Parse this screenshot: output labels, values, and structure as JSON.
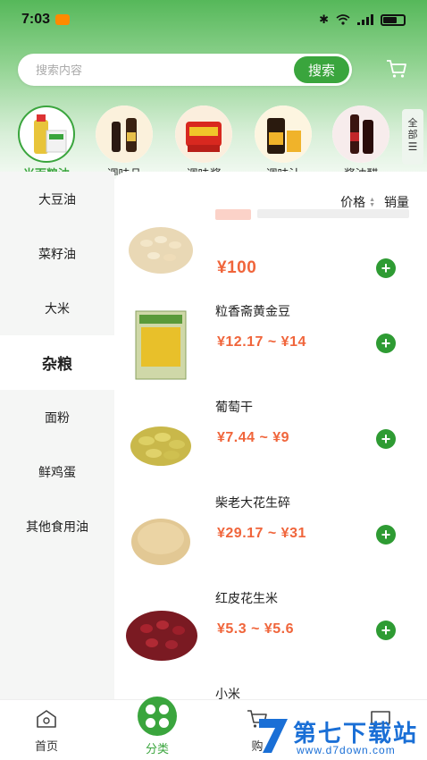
{
  "status_bar": {
    "time": "7:03"
  },
  "search": {
    "placeholder": "搜索内容",
    "button_label": "搜索"
  },
  "categories": [
    {
      "label": "米面粮油",
      "active": true
    },
    {
      "label": "调味品",
      "active": false
    },
    {
      "label": "调味酱",
      "active": false
    },
    {
      "label": "调味汁",
      "active": false
    },
    {
      "label": "酱油醋",
      "active": false
    }
  ],
  "all_button": {
    "label_line1": "全",
    "label_line2": "部"
  },
  "sidebar": {
    "items": [
      {
        "label": "大豆油"
      },
      {
        "label": "菜籽油"
      },
      {
        "label": "大米"
      },
      {
        "label": "杂粮",
        "active": true
      },
      {
        "label": "面粉"
      },
      {
        "label": "鲜鸡蛋"
      },
      {
        "label": "其他食用油"
      }
    ]
  },
  "sort": {
    "price_label": "价格",
    "sales_label": "销量"
  },
  "products": [
    {
      "name": "",
      "price": "¥100"
    },
    {
      "name": "粒香斋黄金豆",
      "price": "¥12.17 ~ ¥14"
    },
    {
      "name": "葡萄干",
      "price": "¥7.44 ~ ¥9"
    },
    {
      "name": "柴老大花生碎",
      "price": "¥29.17 ~ ¥31"
    },
    {
      "name": "红皮花生米",
      "price": "¥5.3 ~ ¥5.6"
    },
    {
      "name": "小米",
      "price": ""
    }
  ],
  "tabbar": {
    "home_label": "首页",
    "category_label": "分类",
    "cart_label": "购"
  },
  "watermark": {
    "title": "第七下载站",
    "url": "www.d7down.com"
  },
  "colors": {
    "accent": "#3aa53d",
    "price": "#f0653b"
  }
}
